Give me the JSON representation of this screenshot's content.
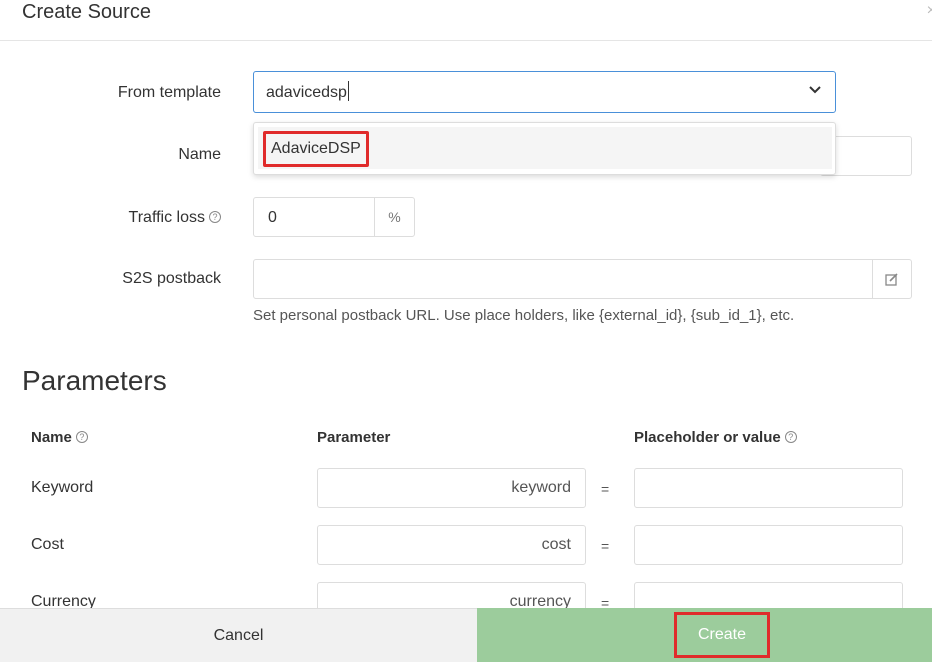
{
  "header": {
    "title": "Create Source",
    "close_label": "×"
  },
  "form": {
    "from_template_label": "From template",
    "from_template_value": "adavicedsp",
    "dropdown_option": "AdaviceDSP",
    "name_label": "Name",
    "traffic_loss_label": "Traffic loss",
    "traffic_loss_value": "0",
    "traffic_loss_unit": "%",
    "s2s_label": "S2S postback",
    "s2s_hint": "Set personal postback URL. Use place holders, like {external_id}, {sub_id_1}, etc.",
    "help_glyph": "?"
  },
  "parameters": {
    "title": "Parameters",
    "headers": {
      "name": "Name",
      "parameter": "Parameter",
      "placeholder": "Placeholder or value"
    },
    "equals": "=",
    "rows": [
      {
        "name": "Keyword",
        "parameter": "keyword"
      },
      {
        "name": "Cost",
        "parameter": "cost"
      },
      {
        "name": "Currency",
        "parameter": "currency"
      }
    ]
  },
  "footer": {
    "cancel_label": "Cancel",
    "create_label": "Create"
  },
  "colors": {
    "accent_blue": "#4a90d9",
    "create_green": "#9ccc9c",
    "highlight_red": "#e02b2b"
  }
}
